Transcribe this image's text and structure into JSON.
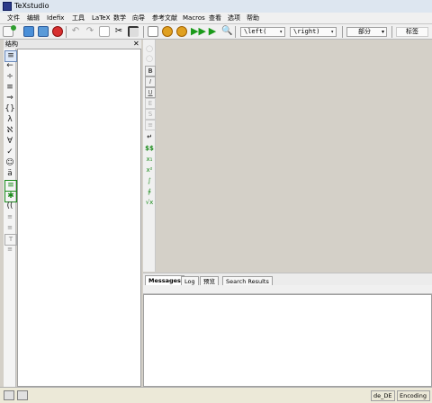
{
  "window": {
    "title": "TeXstudio"
  },
  "menu": [
    "文件",
    "编辑",
    "Idefix",
    "工具",
    "LaTeX",
    "数学",
    "向导",
    "参考文献",
    "Macros",
    "查看",
    "选项",
    "帮助"
  ],
  "toolbar": {
    "left_delim": "\\left(",
    "right_delim": "\\right)",
    "part": "部分",
    "label": "标签"
  },
  "structure": {
    "title": "结构",
    "close": "✕"
  },
  "symbols": [
    "≡",
    "←",
    "÷",
    "≡",
    "⇒",
    "{}",
    "λ",
    "ℵ",
    "∀",
    "✓",
    "☺",
    "ä",
    "≡",
    "✱",
    "((",
    "≡",
    "≡",
    "T",
    "≡"
  ],
  "editor_tools": [
    "◯",
    "◯",
    "B",
    "I",
    "U",
    "E",
    "S",
    "≡",
    "↵",
    "$$",
    "x₁",
    "x²",
    "∫",
    "∳",
    "√x"
  ],
  "messages": {
    "tabs": [
      "Messages",
      "Log",
      "预览",
      "Search Results"
    ],
    "active": 0
  },
  "status": {
    "language": "de_DE",
    "encoding": "Encoding"
  }
}
